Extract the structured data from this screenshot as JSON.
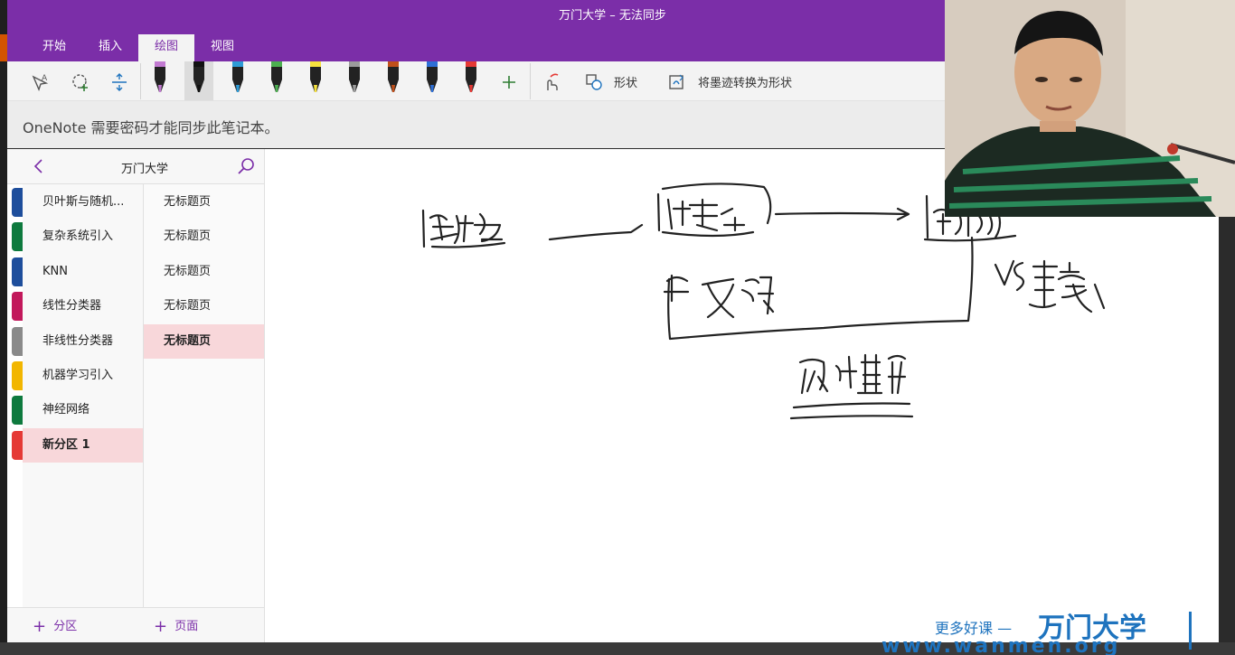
{
  "window": {
    "title": "万门大学 – 无法同步"
  },
  "ribbon": {
    "tabs": [
      {
        "label": "开始"
      },
      {
        "label": "插入"
      },
      {
        "label": "绘图"
      },
      {
        "label": "视图"
      }
    ],
    "active_tab": "绘图"
  },
  "toolbar": {
    "tools": [
      {
        "icon": "lasso-text-select-icon"
      },
      {
        "icon": "lasso-add-space-icon"
      },
      {
        "icon": "insert-space-icon"
      }
    ],
    "pens": [
      {
        "color": "#c27ad1"
      },
      {
        "color": "#111111"
      },
      {
        "color": "#2e9bd6"
      },
      {
        "color": "#4caf50"
      },
      {
        "color": "#f7e23e"
      },
      {
        "color": "#9b9b9b"
      },
      {
        "color": "#c0501b"
      },
      {
        "color": "#2e6fd6"
      },
      {
        "color": "#e53935"
      }
    ],
    "add_pen_icon": "plus-icon",
    "touch_draw_icon": "touch-draw-icon",
    "shapes_label": "形状",
    "ink_to_shape_label": "将墨迹转换为形状"
  },
  "message": {
    "text": "OneNote 需要密码才能同步此笔记本。"
  },
  "notebook": {
    "name": "万门大学",
    "back_icon": "chevron-left-icon",
    "search_icon": "search-icon",
    "sections": [
      {
        "label": "贝叶斯与随机...",
        "color": "#1e4e9c"
      },
      {
        "label": "复杂系统引入",
        "color": "#0e7a3e"
      },
      {
        "label": "KNN",
        "color": "#1e4e9c"
      },
      {
        "label": "线性分类器",
        "color": "#c2185b"
      },
      {
        "label": "非线性分类器",
        "color": "#8a8a8a"
      },
      {
        "label": "机器学习引入",
        "color": "#f2b600"
      },
      {
        "label": "神经网络",
        "color": "#0e7a3e"
      },
      {
        "label": "新分区 1",
        "color": "#e53935"
      }
    ],
    "selected_section": "新分区 1",
    "pages": [
      {
        "label": "无标题页"
      },
      {
        "label": "无标题页"
      },
      {
        "label": "无标题页"
      },
      {
        "label": "无标题页"
      },
      {
        "label": "无标题页"
      }
    ],
    "add_section_label": "分区",
    "add_page_label": "页面"
  },
  "watermark": {
    "tagline": "更多好课 —",
    "brand": "万门大学",
    "url": "www.wanmen.org"
  },
  "colors": {
    "accent": "#7b2ea8",
    "selected_bg": "#f8d7da",
    "watermark": "#1e73be"
  }
}
